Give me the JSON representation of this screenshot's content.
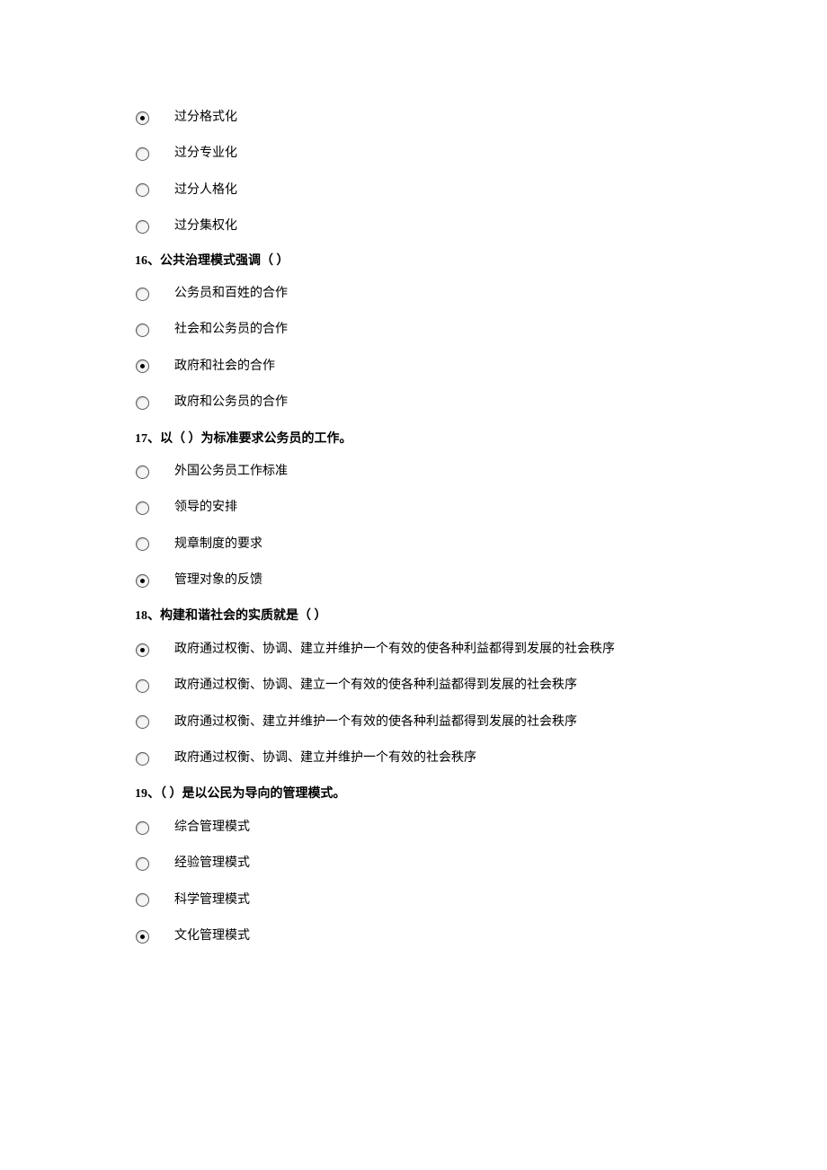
{
  "orphan_options": [
    {
      "label": "过分格式化",
      "checked": true
    },
    {
      "label": "过分专业化",
      "checked": false
    },
    {
      "label": "过分人格化",
      "checked": false
    },
    {
      "label": "过分集权化",
      "checked": false
    }
  ],
  "questions": [
    {
      "text": "16、公共治理模式强调（ ）",
      "options": [
        {
          "label": "公务员和百姓的合作",
          "checked": false
        },
        {
          "label": "社会和公务员的合作",
          "checked": false
        },
        {
          "label": "政府和社会的合作",
          "checked": true
        },
        {
          "label": "政府和公务员的合作",
          "checked": false
        }
      ]
    },
    {
      "text": "17、以（ ）为标准要求公务员的工作。",
      "options": [
        {
          "label": "外国公务员工作标准",
          "checked": false
        },
        {
          "label": "领导的安排",
          "checked": false
        },
        {
          "label": "规章制度的要求",
          "checked": false
        },
        {
          "label": "管理对象的反馈",
          "checked": true
        }
      ]
    },
    {
      "text": "18、构建和谐社会的实质就是（ ）",
      "options": [
        {
          "label": "政府通过权衡、协调、建立并维护一个有效的使各种利益都得到发展的社会秩序",
          "checked": true
        },
        {
          "label": "政府通过权衡、协调、建立一个有效的使各种利益都得到发展的社会秩序",
          "checked": false
        },
        {
          "label": "政府通过权衡、建立并维护一个有效的使各种利益都得到发展的社会秩序",
          "checked": false
        },
        {
          "label": "政府通过权衡、协调、建立并维护一个有效的社会秩序",
          "checked": false
        }
      ]
    },
    {
      "text": "19、（ ）是以公民为导向的管理模式。",
      "options": [
        {
          "label": "综合管理模式",
          "checked": false
        },
        {
          "label": "经验管理模式",
          "checked": false
        },
        {
          "label": "科学管理模式",
          "checked": false
        },
        {
          "label": "文化管理模式",
          "checked": true
        }
      ]
    }
  ]
}
